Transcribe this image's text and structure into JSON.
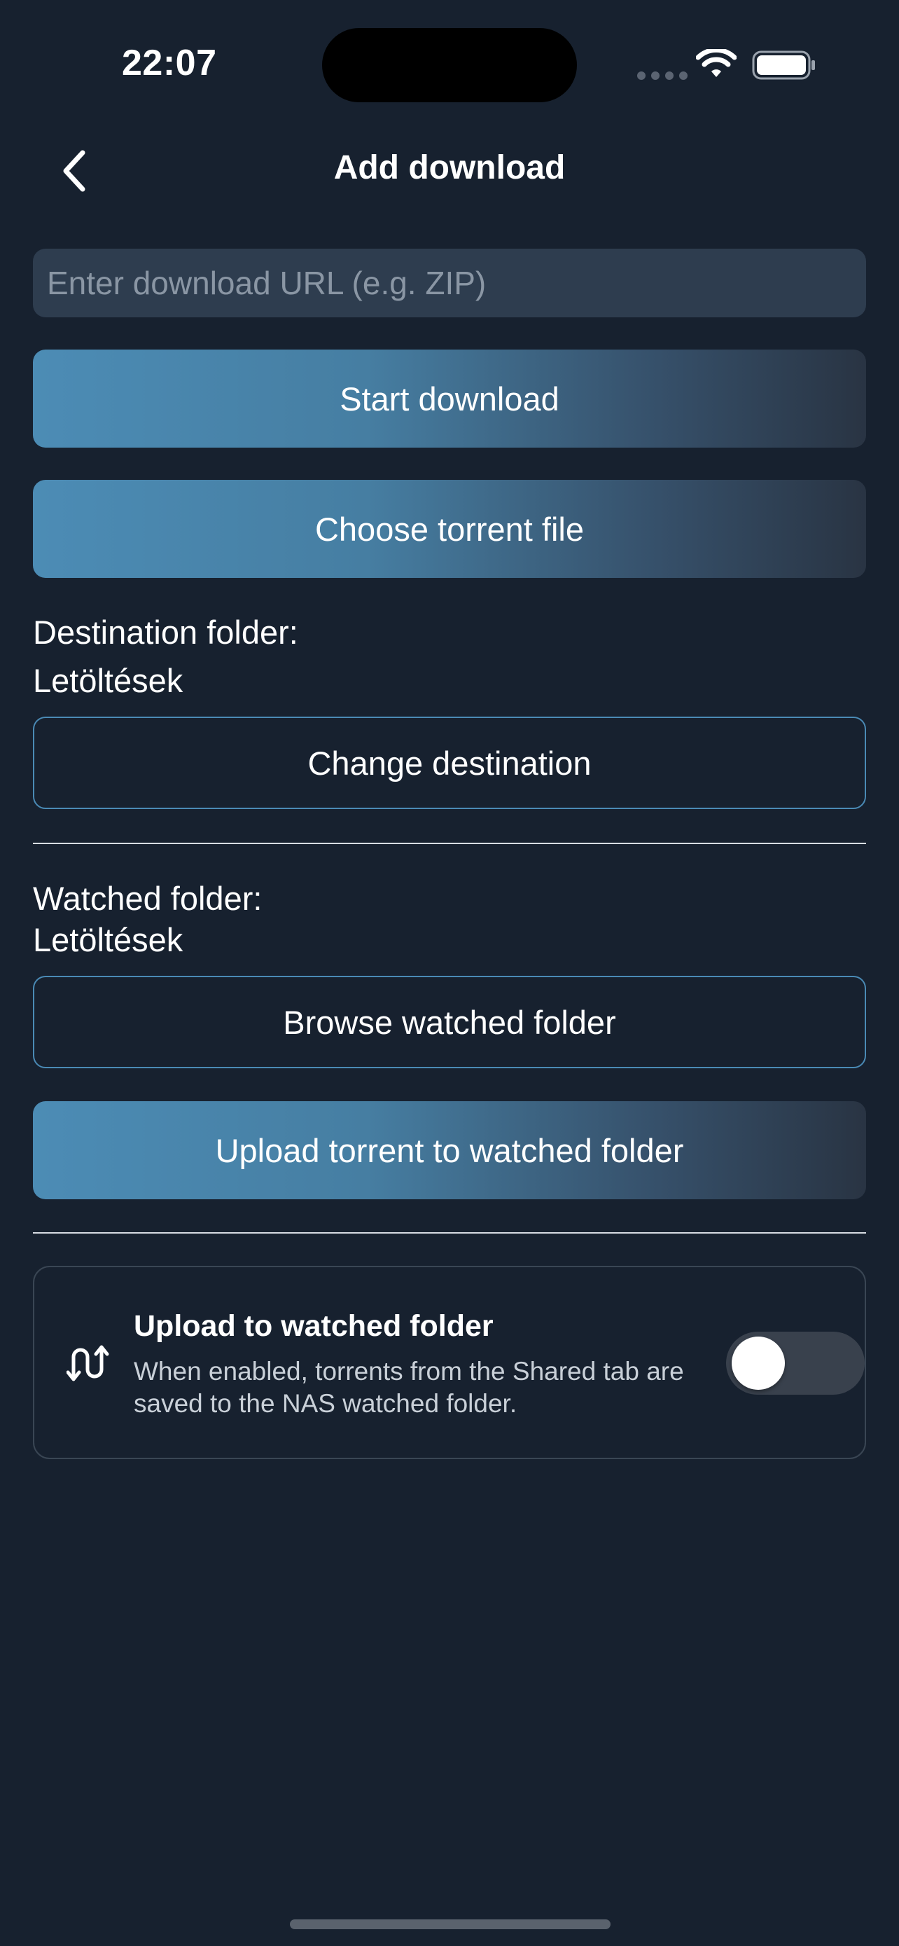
{
  "status_bar": {
    "time": "22:07"
  },
  "header": {
    "title": "Add download",
    "back_icon": "chevron-left-icon"
  },
  "url_input": {
    "placeholder": "Enter download URL (e.g. ZIP)",
    "value": ""
  },
  "actions": {
    "start_download": "Start download",
    "choose_torrent": "Choose torrent file"
  },
  "destination": {
    "label": "Destination folder:",
    "value": "Letöltések",
    "change_button": "Change destination"
  },
  "watched": {
    "label": "Watched folder:",
    "value": "Letöltések",
    "browse_button": "Browse watched folder",
    "upload_button": "Upload torrent to watched folder"
  },
  "upload_setting": {
    "icon": "swap-arrows-icon",
    "title": "Upload to watched folder",
    "description": "When enabled, torrents from the Shared tab are saved to the NAS watched folder.",
    "enabled": false
  },
  "colors": {
    "background": "#17212f",
    "accent": "#4a8ab5",
    "input_bg": "#2e3d4f",
    "toggle_off": "#39414d"
  }
}
